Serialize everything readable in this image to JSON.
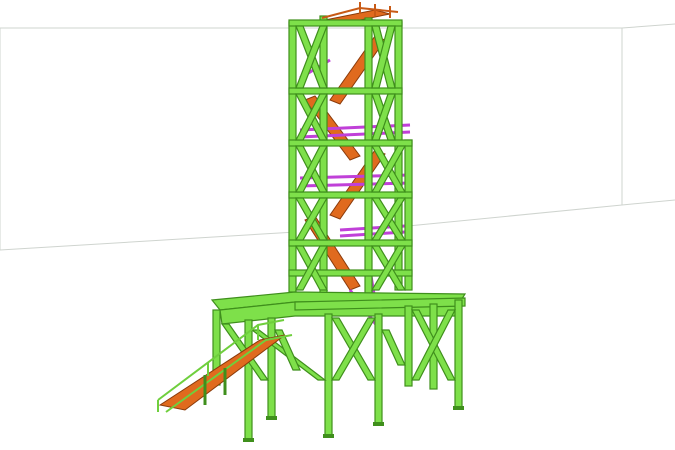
{
  "viewport": {
    "background": "#ffffff",
    "label": ""
  },
  "colors": {
    "structure_steel": "#7ee04a",
    "structure_edge": "#3f8f1c",
    "handrail": "#c040d8",
    "stair": "#e06a1e",
    "stair_edge": "#8a3a0a",
    "room_lines": "#cfd4cf"
  },
  "model": {
    "type": "3d-steel-structure",
    "view": "isometric",
    "components": [
      {
        "name": "tower-frame",
        "color_key": "structure_steel"
      },
      {
        "name": "lower-platform",
        "color_key": "structure_steel"
      },
      {
        "name": "handrails",
        "color_key": "handrail"
      },
      {
        "name": "internal-stairs",
        "color_key": "stair"
      },
      {
        "name": "external-stair",
        "color_key": "stair"
      }
    ]
  }
}
